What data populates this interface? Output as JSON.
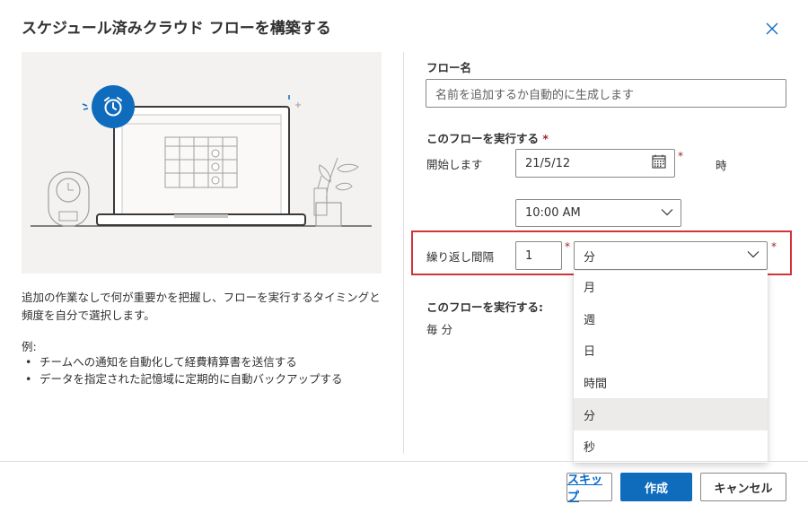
{
  "dialog": {
    "title": "スケジュール済みクラウド フローを構築する"
  },
  "left": {
    "description": "追加の作業なしで何が重要かを把握し、フローを実行するタイミングと頻度を自分で選択します。",
    "example_title": "例:",
    "examples": [
      "チームへの通知を自動化して経費精算書を送信する",
      "データを指定された記憶域に定期的に自動バックアップする"
    ]
  },
  "form": {
    "flow_name_label": "フロー名",
    "flow_name_placeholder": "名前を追加するか自動的に生成します",
    "run_label": "このフローを実行する",
    "required_mark": "*",
    "start_label": "開始します",
    "start_date": "21/5/12",
    "time_unit_label": "時",
    "start_time": "10:00 AM",
    "repeat_label": "繰り返し間隔",
    "repeat_value": "1",
    "repeat_unit": "分",
    "summary_label": "このフローを実行する:",
    "summary_value": "毎 分"
  },
  "dropdown": {
    "options": [
      "月",
      "週",
      "日",
      "時間",
      "分",
      "秒"
    ],
    "selected_index": 4
  },
  "buttons": {
    "skip": "スキップ",
    "create": "作成",
    "cancel": "キャンセル"
  },
  "icons": {
    "close": "close-icon",
    "calendar": "calendar-icon",
    "chevron": "chevron-down-icon",
    "alarm": "alarm-clock-icon"
  },
  "colors": {
    "accent": "#0f6cbd",
    "highlight_border": "#d13438",
    "required": "#a4262c"
  }
}
